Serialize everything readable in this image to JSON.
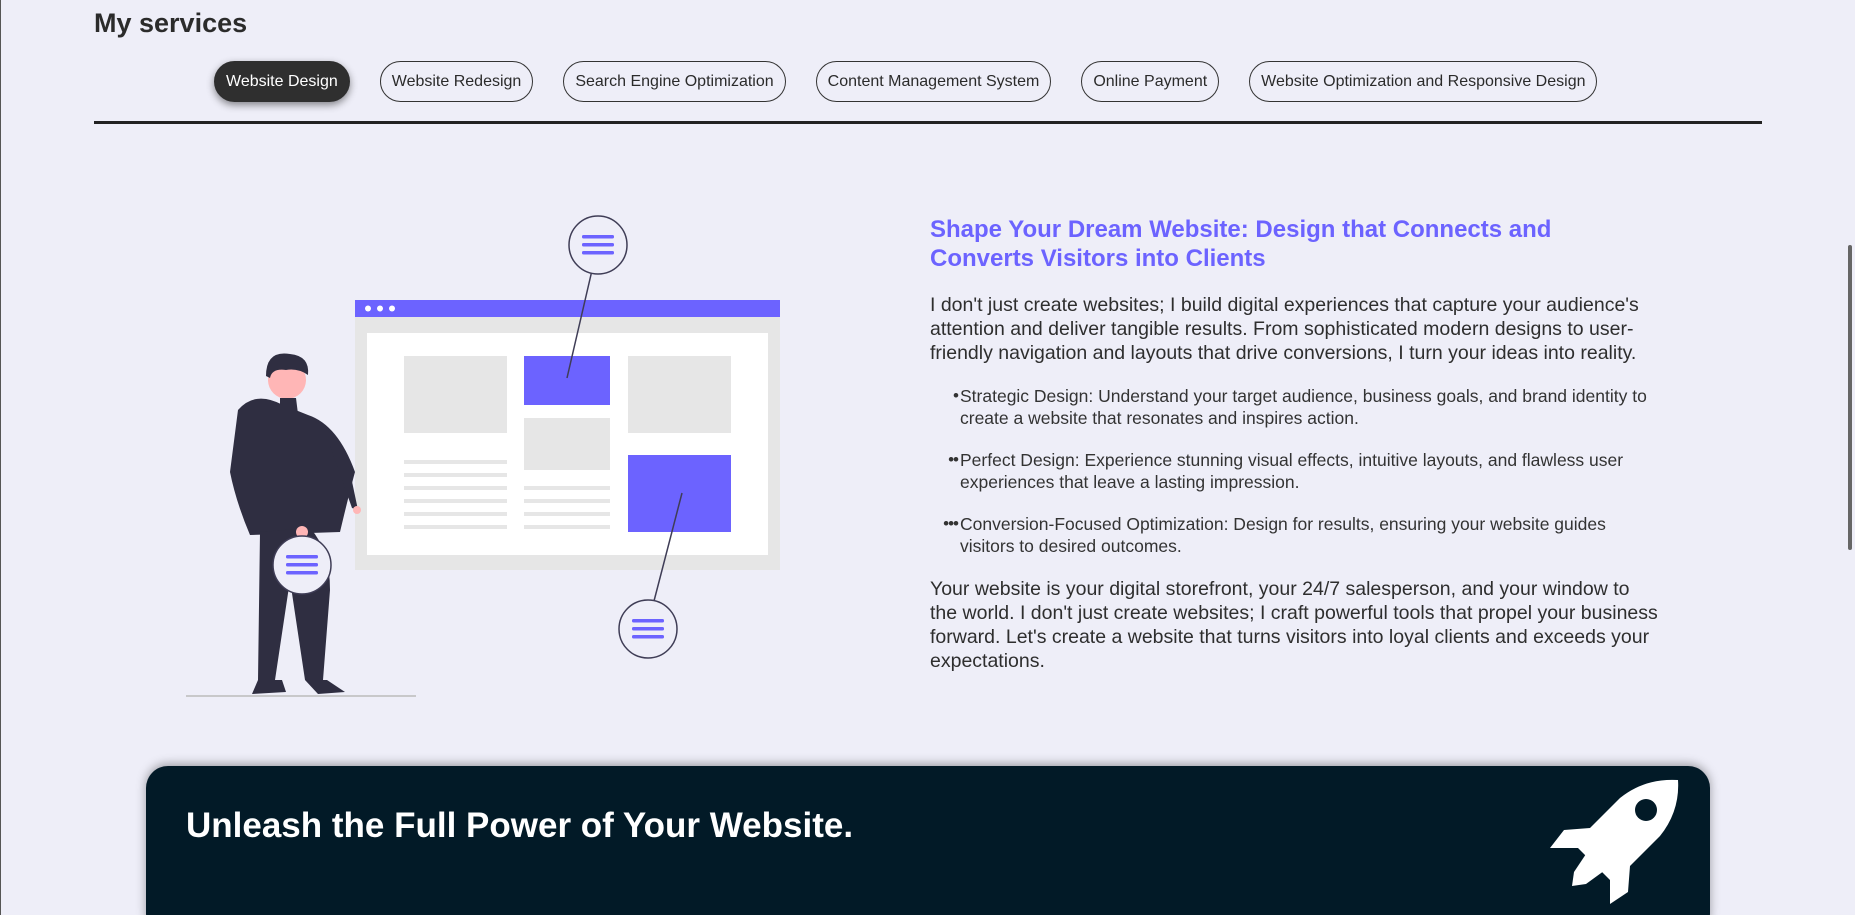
{
  "services": {
    "title": "My services",
    "tabs": [
      {
        "label": "Website Design",
        "active": true
      },
      {
        "label": "Website Redesign",
        "active": false
      },
      {
        "label": "Search Engine Optimization",
        "active": false
      },
      {
        "label": "Content Management System",
        "active": false
      },
      {
        "label": "Online Payment",
        "active": false
      },
      {
        "label": "Website Optimization and Responsive Design",
        "active": false
      }
    ]
  },
  "content": {
    "heading": "Shape Your Dream Website: Design that Connects and Converts Visitors into Clients",
    "intro": "I don't just create websites; I build digital experiences that capture your audience's attention and deliver tangible results. From sophisticated modern designs to user-friendly navigation and layouts that drive conversions, I turn your ideas into reality.",
    "features": [
      {
        "marker": "•",
        "text": "Strategic Design: Understand your target audience, business goals, and brand identity to create a website that resonates and inspires action."
      },
      {
        "marker": "••",
        "text": "Perfect Design: Experience stunning visual effects, intuitive layouts, and flawless user experiences that leave a lasting impression."
      },
      {
        "marker": "•••",
        "text": "Conversion-Focused Optimization: Design for results, ensuring your website guides visitors to desired outcomes."
      }
    ],
    "outro": "Your website is your digital storefront, your 24/7 salesperson, and your window to the world. I don't just create websites; I craft powerful tools that propel your business forward. Let's create a website that turns visitors into loyal clients and exceeds your expectations."
  },
  "banner": {
    "title": "Unleash the Full Power of Your Website.",
    "icon": "rocket-icon"
  },
  "colors": {
    "accent": "#6c63ff",
    "background": "#eeeef8",
    "banner": "#021a27",
    "active_tab": "#2f2f2f"
  }
}
